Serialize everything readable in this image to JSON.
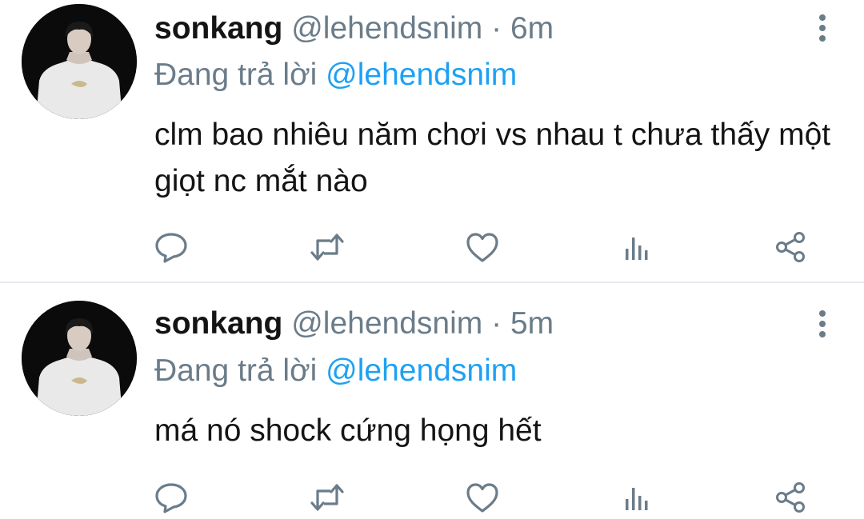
{
  "tweets": [
    {
      "display_name": "sonkang",
      "handle": "@lehendsnim",
      "separator": "·",
      "time": "6m",
      "reply_prefix": "Đang trả lời",
      "reply_to": "@lehendsnim",
      "text": "clm bao nhiêu năm chơi vs nhau t chưa thấy một giọt nc mắt nào"
    },
    {
      "display_name": "sonkang",
      "handle": "@lehendsnim",
      "separator": "·",
      "time": "5m",
      "reply_prefix": "Đang trả lời",
      "reply_to": "@lehendsnim",
      "text": "má nó shock cứng họng hết"
    }
  ],
  "icons": {
    "reply": "reply-icon",
    "retweet": "retweet-icon",
    "like": "heart-icon",
    "stats": "analytics-icon",
    "share": "share-icon",
    "more": "more-vertical-icon"
  },
  "colors": {
    "text": "#141414",
    "secondary": "#6b7c89",
    "mention": "#1da1f2",
    "divider": "#e6ecf0"
  }
}
